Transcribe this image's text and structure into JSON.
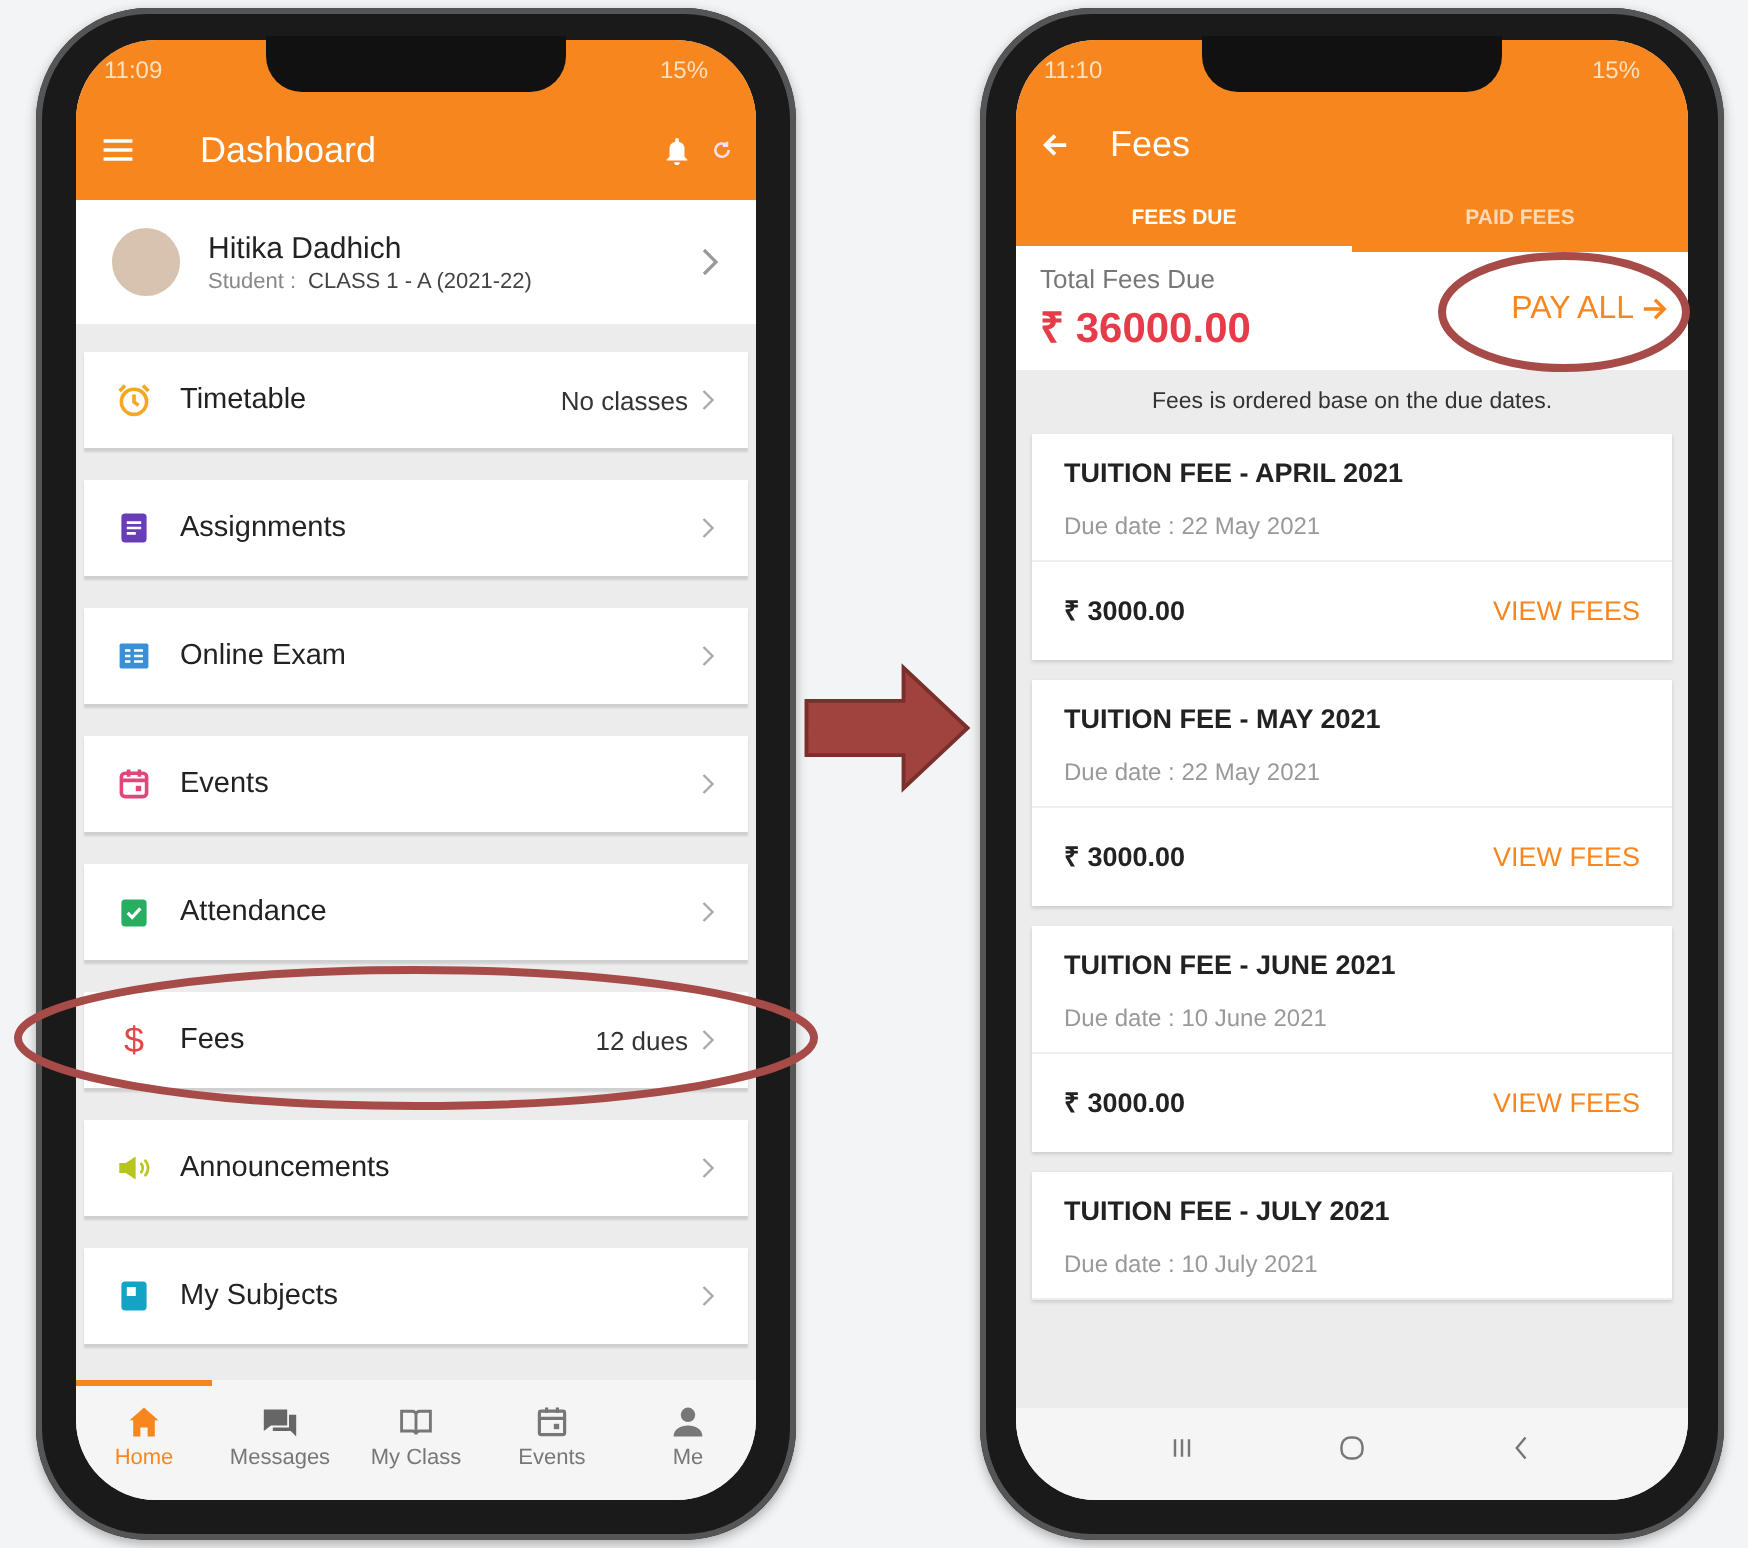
{
  "left_phone": {
    "status_bar": {
      "time": "11:09",
      "battery": "15%"
    },
    "app_bar": {
      "title": "Dashboard"
    },
    "profile": {
      "name": "Hitika Dadhich",
      "role_label": "Student :",
      "class": "CLASS 1 - A (2021-22)"
    },
    "menu_items": [
      {
        "label": "Timetable",
        "badge": "No classes"
      },
      {
        "label": "Assignments"
      },
      {
        "label": "Online Exam"
      },
      {
        "label": "Events"
      },
      {
        "label": "Attendance"
      },
      {
        "label": "Fees",
        "icon_char": "$",
        "badge": "12 dues"
      },
      {
        "label": "Announcements"
      },
      {
        "label": "My Subjects"
      }
    ],
    "bottom_nav": [
      {
        "label": "Home",
        "selected": true
      },
      {
        "label": "Messages",
        "selected": false
      },
      {
        "label": "My Class",
        "selected": false
      },
      {
        "label": "Events",
        "selected": false
      },
      {
        "label": "Me",
        "selected": false
      }
    ]
  },
  "right_phone": {
    "status_bar": {
      "time": "11:10",
      "battery": "15%"
    },
    "app_bar": {
      "title": "Fees"
    },
    "tabs": [
      {
        "label": "FEES DUE",
        "selected": true
      },
      {
        "label": "PAID FEES",
        "selected": false
      }
    ],
    "total": {
      "label": "Total Fees Due",
      "amount": "₹ 36000.00"
    },
    "pay_all": "PAY ALL",
    "note": "Fees is ordered base on the due dates.",
    "fees": [
      {
        "title": "TUITION FEE - APRIL 2021",
        "due_date": "Due date : 22 May 2021",
        "amount": "₹ 3000.00",
        "action": "VIEW FEES"
      },
      {
        "title": "TUITION FEE - MAY 2021",
        "due_date": "Due date : 22 May 2021",
        "amount": "₹ 3000.00",
        "action": "VIEW FEES"
      },
      {
        "title": "TUITION FEE - JUNE 2021",
        "due_date": "Due date : 10 June 2021",
        "amount": "₹ 3000.00",
        "action": "VIEW FEES"
      },
      {
        "title": "TUITION FEE - JULY 2021",
        "due_date": "Due date : 10 July 2021"
      }
    ]
  }
}
